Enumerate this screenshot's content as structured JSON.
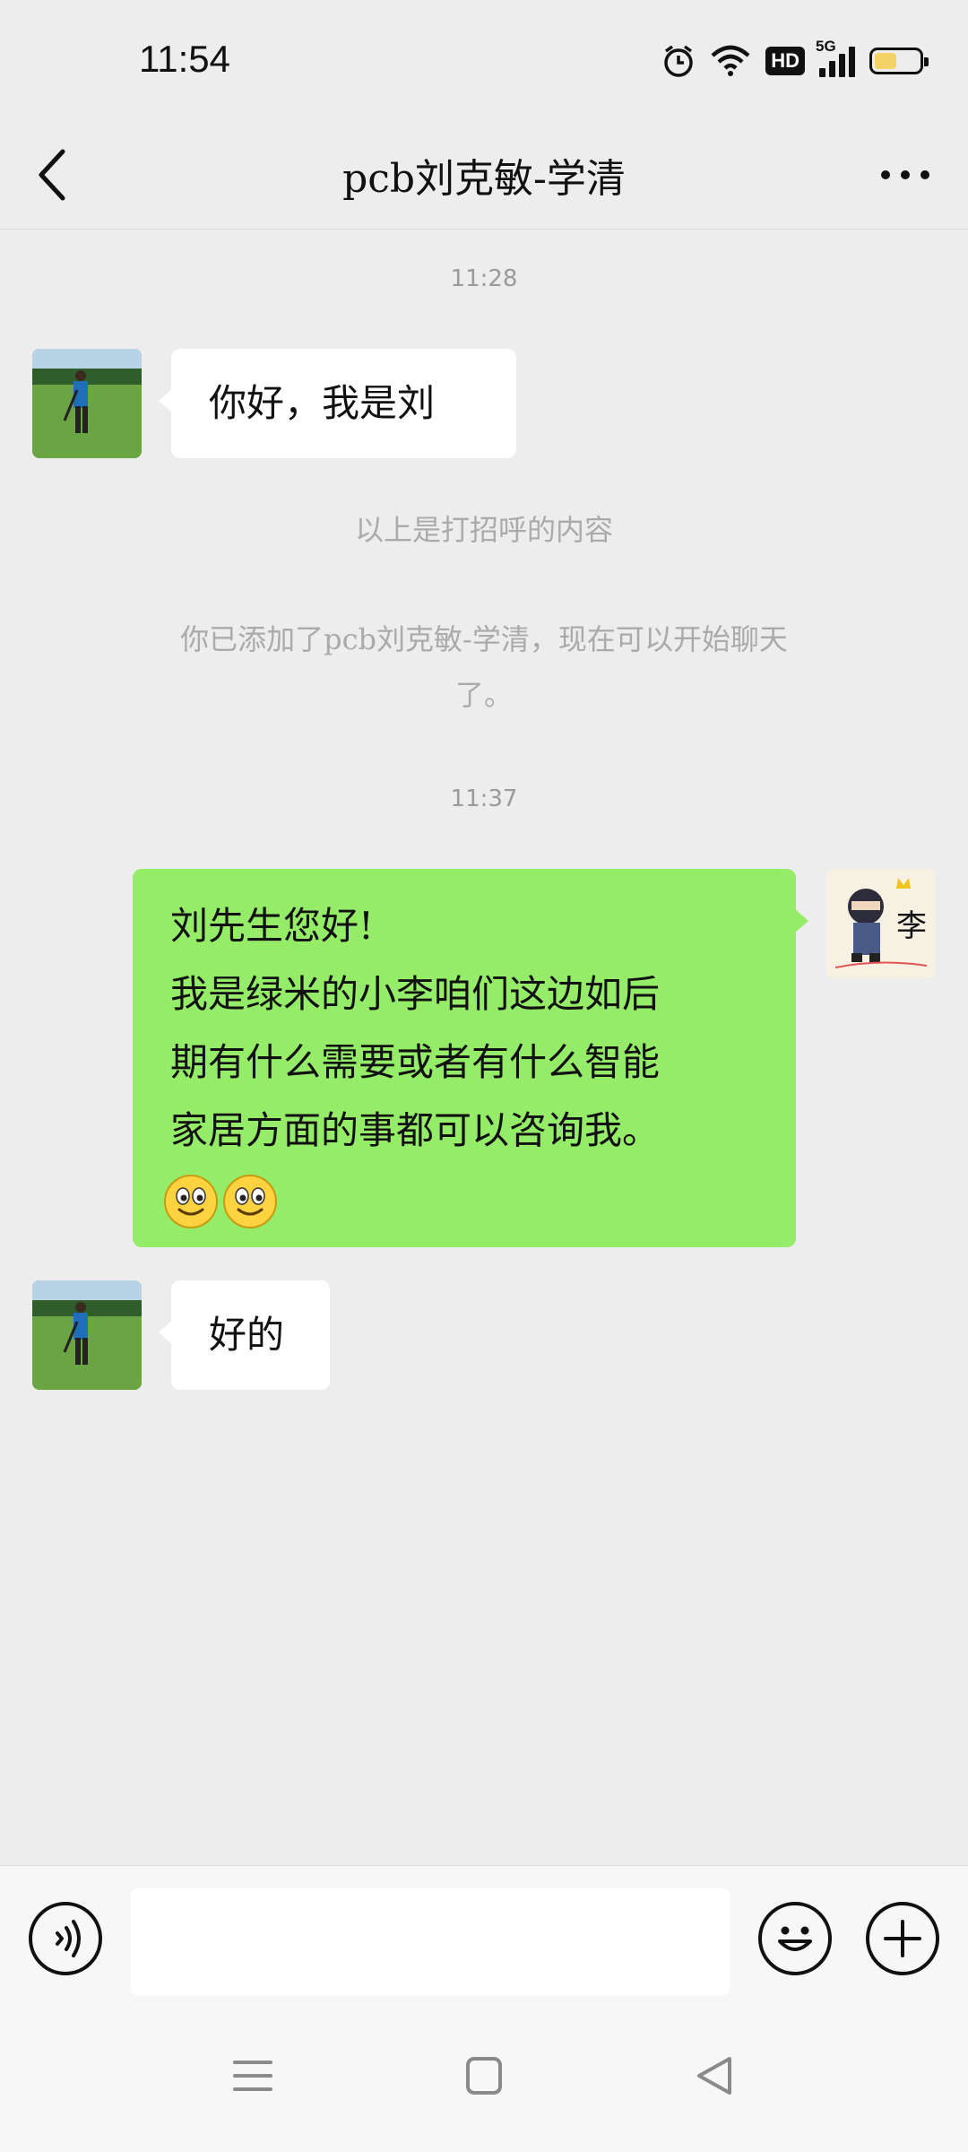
{
  "status": {
    "time": "11:54",
    "hd_label": "HD",
    "network_label": "5G",
    "battery_level": 0.5,
    "battery_color": "#f3d266"
  },
  "header": {
    "title": "pcb刘克敏-学清"
  },
  "messages": {
    "ts1": "11:28",
    "m1_text": "你好，我是刘",
    "system_greeting": "以上是打招呼的内容",
    "system_added_line1": "你已添加了pcb刘克敏-学清，现在可以开始聊天",
    "system_added_line2": "了。",
    "ts2": "11:37",
    "m2_line1": "刘先生您好!",
    "m2_line2": "我是绿米的小李咱们这边如后",
    "m2_line3": "期有什么需要或者有什么智能",
    "m2_line4": "家居方面的事都可以咨询我。",
    "m2_emojis": [
      "smiley-emoji",
      "smiley-emoji"
    ],
    "m3_text": "好的",
    "avatar_me_text": "李"
  },
  "colors": {
    "chat_bg": "#ededed",
    "sent_bubble": "#95ec69",
    "received_bubble": "#ffffff"
  },
  "icons": {
    "back": "chevron-left-icon",
    "more": "more-horizontal-icon",
    "voice": "voice-icon",
    "emoji": "emoji-icon",
    "plus": "plus-icon"
  },
  "input": {
    "value": ""
  }
}
